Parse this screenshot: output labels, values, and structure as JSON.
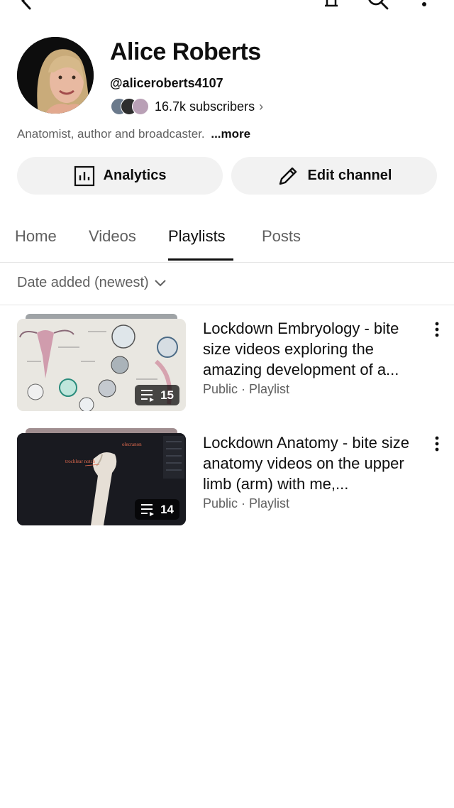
{
  "top_bar": {
    "icons": [
      "back-arrow-icon",
      "notifications-bell-icon",
      "search-icon",
      "more-vert-icon"
    ]
  },
  "channel": {
    "name": "Alice Roberts",
    "handle": "@aliceroberts4107",
    "subscribers": "16.7k subscribers",
    "subscribers_chevron": "›",
    "description": "Anatomist, author and broadcaster.",
    "more_label": "...more"
  },
  "actions": {
    "analytics_label": "Analytics",
    "edit_label": "Edit channel"
  },
  "tabs": [
    {
      "label": "Home",
      "active": false
    },
    {
      "label": "Videos",
      "active": false
    },
    {
      "label": "Playlists",
      "active": true
    },
    {
      "label": "Posts",
      "active": false
    }
  ],
  "sort": {
    "label": "Date added (newest)"
  },
  "playlists": [
    {
      "title": "Lockdown Embryology - bite size videos exploring the amazing development of a...",
      "meta": "Public · Playlist",
      "count": "15"
    },
    {
      "title": "Lockdown Anatomy - bite size anatomy videos on the upper limb (arm) with me,...",
      "meta": "Public · Playlist",
      "count": "14",
      "thumb_labels": [
        "olecranon",
        "trochlear notch"
      ]
    }
  ],
  "colors": {
    "text_primary": "#0f0f0f",
    "text_secondary": "#606060",
    "button_bg": "#f2f2f2",
    "divider": "#e5e5e5"
  }
}
